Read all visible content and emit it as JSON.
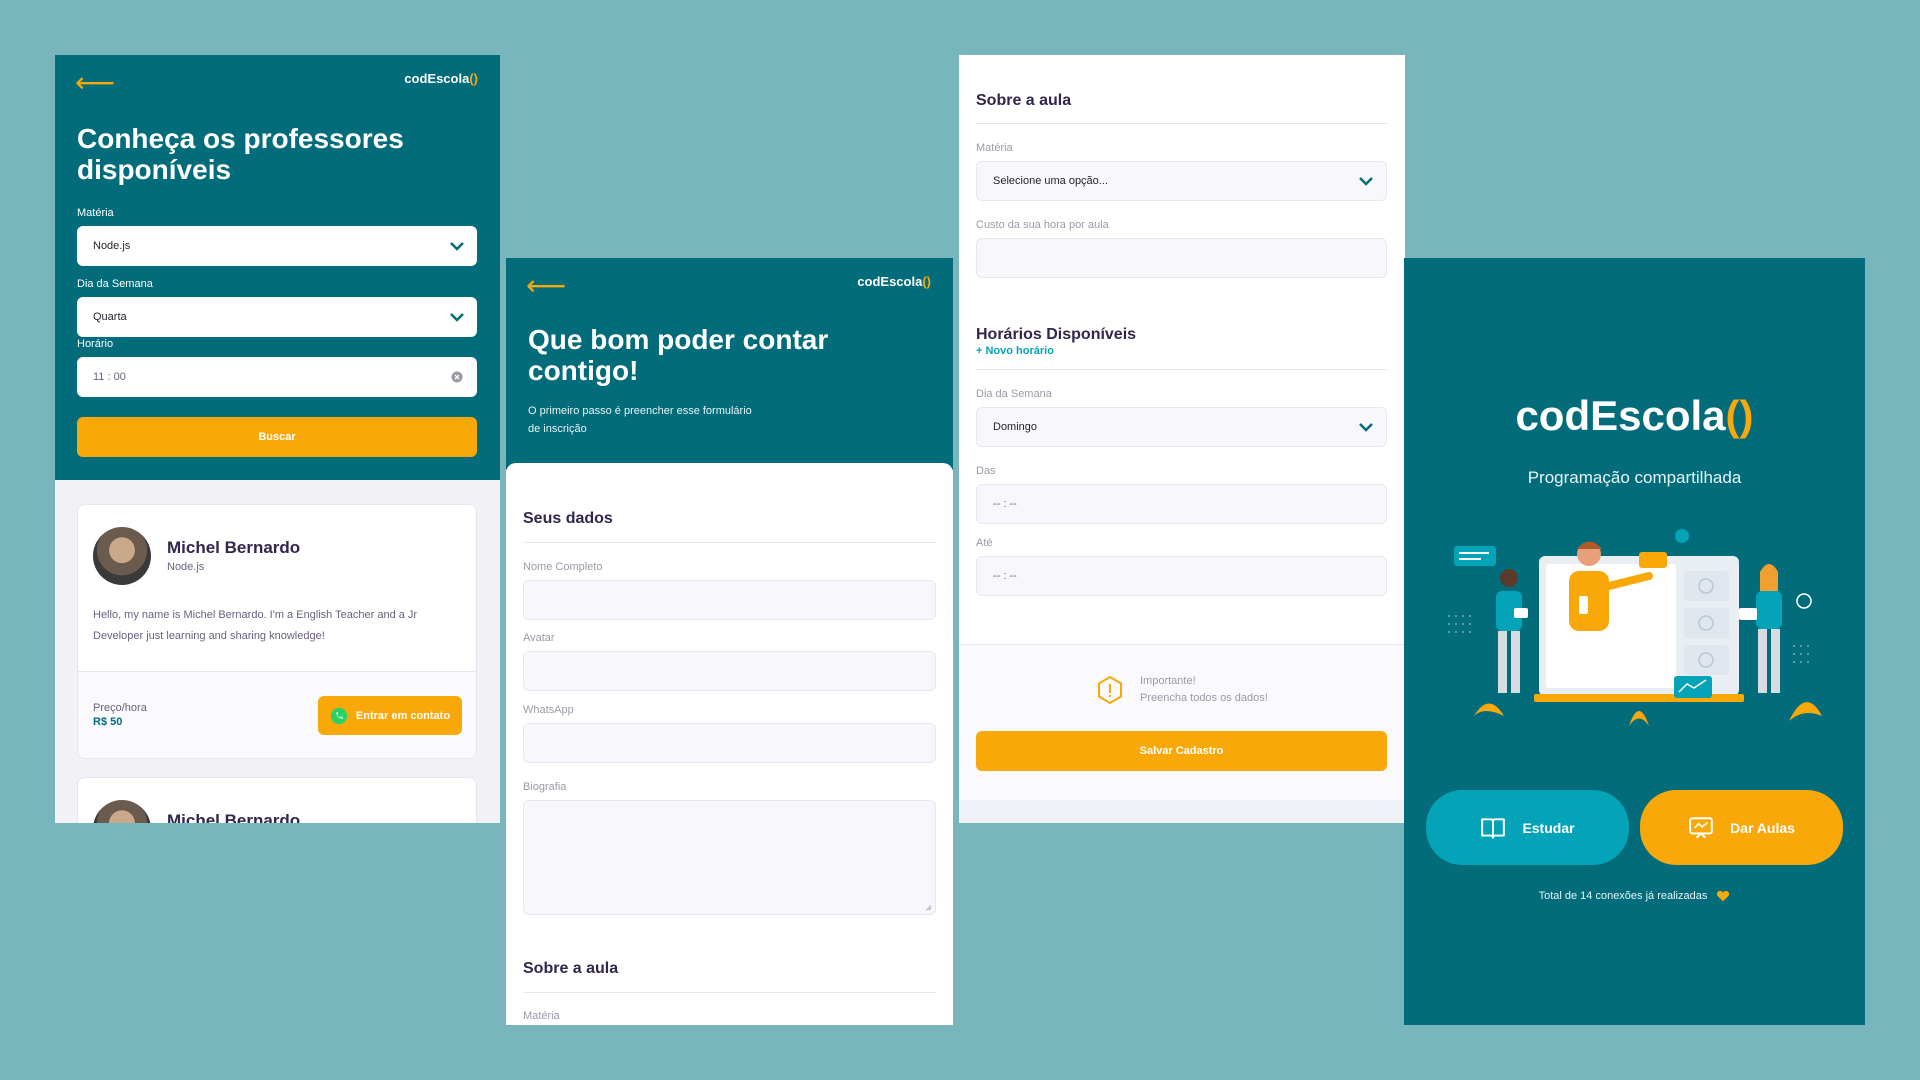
{
  "brand": {
    "name": "codEscola",
    "paren": "()"
  },
  "colors": {
    "background": "#78b5bc",
    "primary": "#026c7a",
    "accent": "#f9a80a",
    "secondary": "#04a3b7"
  },
  "study": {
    "title": "Conheça os professores disponíveis",
    "filters": {
      "subject_label": "Matéria",
      "subject_value": "Node.js",
      "weekday_label": "Dia da Semana",
      "weekday_value": "Quarta",
      "time_label": "Horário",
      "time_value": "11 : 00",
      "search_label": "Buscar"
    },
    "teacher": {
      "name": "Michel Bernardo",
      "subject": "Node.js",
      "bio": "Hello, my name is Michel Bernardo. I'm a English Teacher and a Jr Developer just learning and sharing knowledge!",
      "price_label": "Preço/hora",
      "price_value": "R$ 50",
      "contact_label": "Entrar em contato"
    },
    "teacher2_name": "Michel Bernardo"
  },
  "give": {
    "title": "Que bom poder contar contigo!",
    "subtitle": "O primeiro passo é preencher esse formulário de inscrição",
    "data_section": "Seus dados",
    "name_label": "Nome Completo",
    "avatar_label": "Avatar",
    "whatsapp_label": "WhatsApp",
    "bio_label": "Biografia",
    "class_section": "Sobre a aula",
    "subject_label": "Matéria"
  },
  "form2": {
    "class_section": "Sobre a aula",
    "subject_label": "Matéria",
    "subject_placeholder": "Selecione uma opção...",
    "cost_label": "Custo da sua hora por aula",
    "schedule_section": "Horários Disponíveis",
    "new_schedule": "+ Novo horário",
    "weekday_label": "Dia da Semana",
    "weekday_value": "Domingo",
    "from_label": "Das",
    "from_value": "-- : --",
    "to_label": "Até",
    "to_value": "-- : --",
    "warning_title": "Importante!",
    "warning_text": "Preencha todos os dados!",
    "save_label": "Salvar Cadastro"
  },
  "landing": {
    "subtitle": "Programação compartilhada",
    "study_label": "Estudar",
    "give_label": "Dar Aulas",
    "connections": "Total de 14 conexões já realizadas"
  }
}
